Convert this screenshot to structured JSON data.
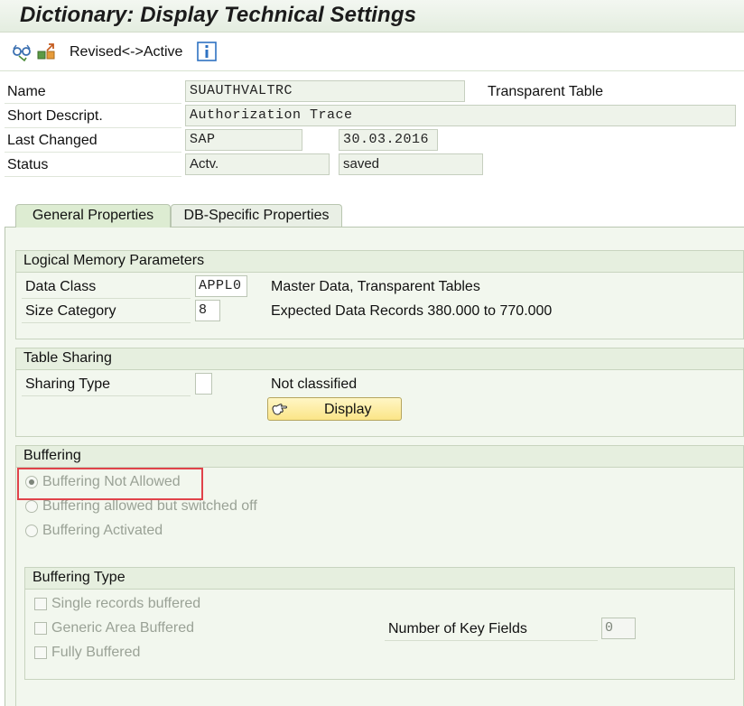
{
  "window": {
    "title": "Dictionary: Display Technical Settings"
  },
  "toolbar": {
    "revised_active_label": "Revised<->Active",
    "icons": [
      "glasses-icon",
      "other-object-icon",
      "info-icon"
    ]
  },
  "header": {
    "name_label": "Name",
    "name_value": "SUAUTHVALTRC",
    "table_type": "Transparent Table",
    "short_desc_label": "Short Descript.",
    "short_desc_value": "Authorization Trace",
    "last_changed_label": "Last Changed",
    "last_changed_user": "SAP",
    "last_changed_date": "30.03.2016",
    "status_label": "Status",
    "status_value": "Actv.",
    "status_saved": "saved"
  },
  "tabs": [
    {
      "label": "General Properties",
      "active": true
    },
    {
      "label": "DB-Specific Properties",
      "active": false
    }
  ],
  "logical_memory": {
    "title": "Logical Memory Parameters",
    "data_class_label": "Data Class",
    "data_class_value": "APPL0",
    "data_class_desc": "Master Data, Transparent Tables",
    "size_category_label": "Size Category",
    "size_category_value": "8",
    "size_category_desc": "Expected Data Records 380.000 to 770.000"
  },
  "table_sharing": {
    "title": "Table Sharing",
    "sharing_type_label": "Sharing Type",
    "sharing_type_value": "",
    "sharing_type_desc": "Not classified",
    "display_button": "Display"
  },
  "buffering": {
    "title": "Buffering",
    "options": [
      {
        "label": "Buffering Not Allowed",
        "selected": true
      },
      {
        "label": "Buffering allowed but switched off",
        "selected": false
      },
      {
        "label": "Buffering Activated",
        "selected": false
      }
    ],
    "type": {
      "title": "Buffering Type",
      "options": [
        {
          "label": "Single records buffered",
          "checked": false
        },
        {
          "label": "Generic Area Buffered",
          "checked": false
        },
        {
          "label": "Fully Buffered",
          "checked": false
        }
      ],
      "key_fields_label": "Number of Key Fields",
      "key_fields_value": "0"
    }
  },
  "colors": {
    "highlight": "#e0434a",
    "panel_bg": "#f2f7ee",
    "button_bg": "#fbe587"
  }
}
